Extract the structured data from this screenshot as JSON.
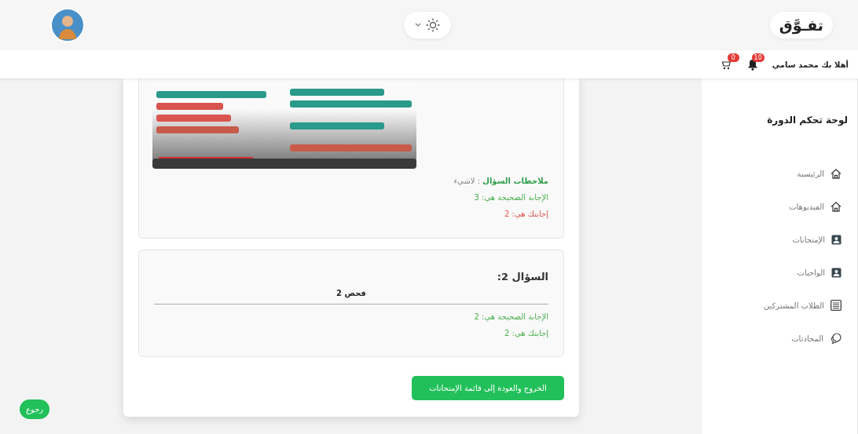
{
  "header": {
    "logo": "تفـوَّق"
  },
  "user_bar": {
    "greeting": "أهلا بك محمد سامي",
    "notifications": "10",
    "cart": "0"
  },
  "sidebar": {
    "title": "لوحة تحكم الدورة",
    "items": [
      {
        "label": "الرئيسية",
        "kind": "home"
      },
      {
        "label": "الفيديوهات",
        "kind": "home"
      },
      {
        "label": "الإمتحانات",
        "kind": "contact"
      },
      {
        "label": "الواجبات",
        "kind": "contact"
      },
      {
        "label": "الطلاب المشتركين",
        "kind": "list"
      },
      {
        "label": "المحادثات",
        "kind": "chat"
      }
    ]
  },
  "questions": [
    {
      "notes_label": "ملاحظات السؤال",
      "notes_value": ": لاشيء",
      "correct_answer": "الإجابة الصحيحة هي: 3",
      "your_answer": {
        "text": "إجابتك هي: 2",
        "correct": false
      }
    },
    {
      "title": "السؤال 2:",
      "body": "فحص 2",
      "correct_answer": "الإجابة الصحيحة هي: 2",
      "your_answer": {
        "text": "إجابتك هي: 2",
        "correct": true
      }
    }
  ],
  "exit_button": "الخروج والعودة إلى قائمة الإمتحانات",
  "back_button": "رجوع"
}
